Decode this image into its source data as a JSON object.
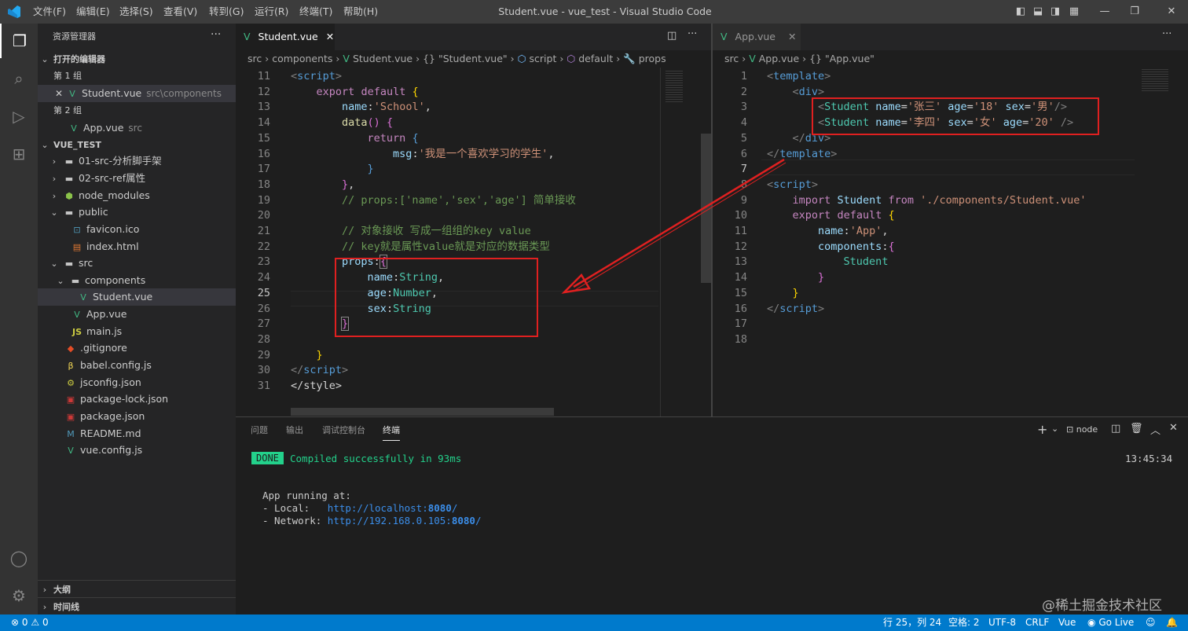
{
  "window": {
    "title": "Student.vue - vue_test - Visual Studio Code",
    "menu": [
      "文件(F)",
      "编辑(E)",
      "选择(S)",
      "查看(V)",
      "转到(G)",
      "运行(R)",
      "终端(T)",
      "帮助(H)"
    ]
  },
  "sidebar": {
    "title": "资源管理器",
    "open_editors": "打开的编辑器",
    "group1": "第 1 组",
    "group1_file": "Student.vue",
    "group1_path": "src\\components",
    "group2": "第 2 组",
    "group2_file": "App.vue",
    "group2_path": "src",
    "project": "VUE_TEST",
    "tree": [
      {
        "name": "01-src-分析脚手架",
        "kind": "folder"
      },
      {
        "name": "02-src-ref属性",
        "kind": "folder"
      },
      {
        "name": "node_modules",
        "kind": "folder"
      },
      {
        "name": "public",
        "kind": "folder"
      },
      {
        "name": "favicon.ico",
        "kind": "file"
      },
      {
        "name": "index.html",
        "kind": "file"
      },
      {
        "name": "src",
        "kind": "folder"
      },
      {
        "name": "components",
        "kind": "folder"
      },
      {
        "name": "Student.vue",
        "kind": "file"
      },
      {
        "name": "App.vue",
        "kind": "file"
      },
      {
        "name": "main.js",
        "kind": "file"
      },
      {
        "name": ".gitignore",
        "kind": "file"
      },
      {
        "name": "babel.config.js",
        "kind": "file"
      },
      {
        "name": "jsconfig.json",
        "kind": "file"
      },
      {
        "name": "package-lock.json",
        "kind": "file"
      },
      {
        "name": "package.json",
        "kind": "file"
      },
      {
        "name": "README.md",
        "kind": "file"
      },
      {
        "name": "vue.config.js",
        "kind": "file"
      }
    ],
    "outline": "大纲",
    "timeline": "时间线"
  },
  "left_editor": {
    "tab": "Student.vue",
    "breadcrumb": [
      "src",
      "components",
      "Student.vue",
      "{} \"Student.vue\"",
      "script",
      "default",
      "props"
    ],
    "line_numbers": [
      "11",
      "12",
      "13",
      "14",
      "15",
      "16",
      "17",
      "18",
      "19",
      "20",
      "21",
      "22",
      "23",
      "24",
      "25",
      "26",
      "27",
      "28",
      "29",
      "30",
      "31"
    ],
    "current_line": "25"
  },
  "right_editor": {
    "tab": "App.vue",
    "breadcrumb": [
      "src",
      "App.vue",
      "{} \"App.vue\""
    ],
    "line_numbers": [
      "1",
      "2",
      "3",
      "4",
      "5",
      "6",
      "7",
      "8",
      "9",
      "10",
      "11",
      "12",
      "13",
      "14",
      "15",
      "16",
      "17",
      "18"
    ],
    "current_line": "7"
  },
  "panel": {
    "tabs": [
      "问题",
      "输出",
      "调试控制台",
      "终端"
    ],
    "active_tab": "终端",
    "terminal_name": "node",
    "done_badge": "DONE",
    "compiled": "Compiled successfully in 93ms",
    "time": "13:45:34",
    "running": "App running at:",
    "local_label": "- Local:   ",
    "local_url_prefix": "http://localhost:",
    "local_port": "8080",
    "network_label": "- Network: ",
    "network_url_prefix": "http://192.168.0.105:",
    "network_port": "8080"
  },
  "statusbar": {
    "errors": "0",
    "warnings": "0",
    "position": "行 25，列 24",
    "spaces": "空格: 2",
    "encoding": "UTF-8",
    "eol": "CRLF",
    "language": "Vue",
    "golive": "Go Live"
  },
  "watermark": "@稀土掘金技术社区",
  "colors": {
    "accent": "#007acc",
    "annotation_red": "#e02020",
    "done_green": "#23d18b"
  }
}
